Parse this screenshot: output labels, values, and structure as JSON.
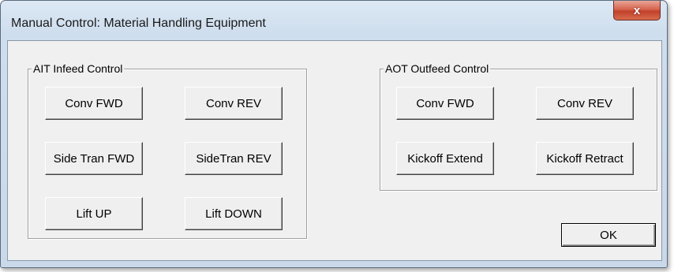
{
  "window": {
    "title": "Manual Control: Material Handling Equipment",
    "close_glyph": "x",
    "close_icon": "close-icon"
  },
  "infeed": {
    "label": "AIT Infeed Control",
    "conv_fwd": "Conv FWD",
    "conv_rev": "Conv REV",
    "side_tran_fwd": "Side Tran FWD",
    "side_tran_rev": "SideTran REV",
    "lift_up": "Lift UP",
    "lift_down": "Lift DOWN"
  },
  "outfeed": {
    "label": "AOT Outfeed Control",
    "conv_fwd": "Conv FWD",
    "conv_rev": "Conv REV",
    "kickoff_extend": "Kickoff Extend",
    "kickoff_retract": "Kickoff Retract"
  },
  "ok_label": "OK",
  "colors": {
    "close_button": "#c2412a",
    "dialog_face": "#f0f0f0",
    "frame": "#cfdeee"
  }
}
